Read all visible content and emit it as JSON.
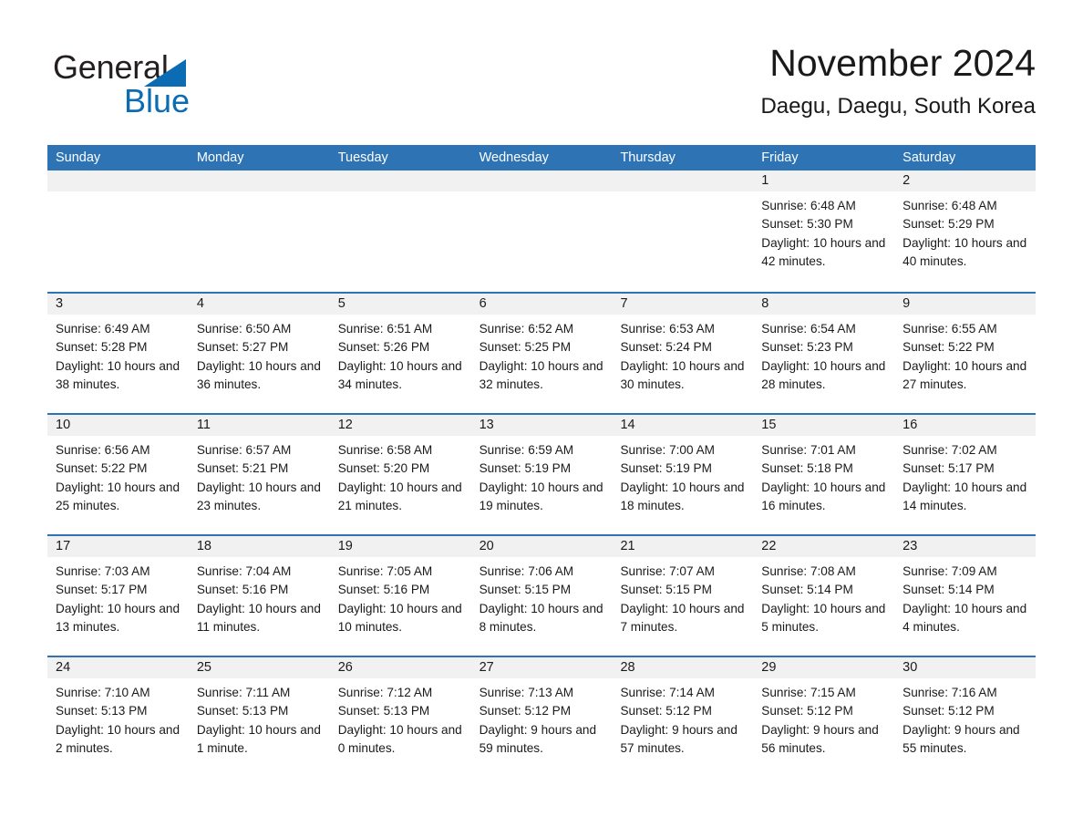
{
  "brand": {
    "name_part1": "General",
    "name_part2": "Blue",
    "triangle_icon": "triangle-icon",
    "colors": {
      "blue": "#0b6cb4",
      "black": "#231f20"
    }
  },
  "header": {
    "title": "November 2024",
    "subtitle": "Daegu, Daegu, South Korea"
  },
  "theme": {
    "header_blue": "#2e74b5",
    "daynum_band": "#f1f1f1",
    "text": "#1a1a1a"
  },
  "weekdays": [
    "Sunday",
    "Monday",
    "Tuesday",
    "Wednesday",
    "Thursday",
    "Friday",
    "Saturday"
  ],
  "weeks": [
    [
      {
        "day": "",
        "sunrise": "",
        "sunset": "",
        "daylight": ""
      },
      {
        "day": "",
        "sunrise": "",
        "sunset": "",
        "daylight": ""
      },
      {
        "day": "",
        "sunrise": "",
        "sunset": "",
        "daylight": ""
      },
      {
        "day": "",
        "sunrise": "",
        "sunset": "",
        "daylight": ""
      },
      {
        "day": "",
        "sunrise": "",
        "sunset": "",
        "daylight": ""
      },
      {
        "day": "1",
        "sunrise": "Sunrise: 6:48 AM",
        "sunset": "Sunset: 5:30 PM",
        "daylight": "Daylight: 10 hours and 42 minutes."
      },
      {
        "day": "2",
        "sunrise": "Sunrise: 6:48 AM",
        "sunset": "Sunset: 5:29 PM",
        "daylight": "Daylight: 10 hours and 40 minutes."
      }
    ],
    [
      {
        "day": "3",
        "sunrise": "Sunrise: 6:49 AM",
        "sunset": "Sunset: 5:28 PM",
        "daylight": "Daylight: 10 hours and 38 minutes."
      },
      {
        "day": "4",
        "sunrise": "Sunrise: 6:50 AM",
        "sunset": "Sunset: 5:27 PM",
        "daylight": "Daylight: 10 hours and 36 minutes."
      },
      {
        "day": "5",
        "sunrise": "Sunrise: 6:51 AM",
        "sunset": "Sunset: 5:26 PM",
        "daylight": "Daylight: 10 hours and 34 minutes."
      },
      {
        "day": "6",
        "sunrise": "Sunrise: 6:52 AM",
        "sunset": "Sunset: 5:25 PM",
        "daylight": "Daylight: 10 hours and 32 minutes."
      },
      {
        "day": "7",
        "sunrise": "Sunrise: 6:53 AM",
        "sunset": "Sunset: 5:24 PM",
        "daylight": "Daylight: 10 hours and 30 minutes."
      },
      {
        "day": "8",
        "sunrise": "Sunrise: 6:54 AM",
        "sunset": "Sunset: 5:23 PM",
        "daylight": "Daylight: 10 hours and 28 minutes."
      },
      {
        "day": "9",
        "sunrise": "Sunrise: 6:55 AM",
        "sunset": "Sunset: 5:22 PM",
        "daylight": "Daylight: 10 hours and 27 minutes."
      }
    ],
    [
      {
        "day": "10",
        "sunrise": "Sunrise: 6:56 AM",
        "sunset": "Sunset: 5:22 PM",
        "daylight": "Daylight: 10 hours and 25 minutes."
      },
      {
        "day": "11",
        "sunrise": "Sunrise: 6:57 AM",
        "sunset": "Sunset: 5:21 PM",
        "daylight": "Daylight: 10 hours and 23 minutes."
      },
      {
        "day": "12",
        "sunrise": "Sunrise: 6:58 AM",
        "sunset": "Sunset: 5:20 PM",
        "daylight": "Daylight: 10 hours and 21 minutes."
      },
      {
        "day": "13",
        "sunrise": "Sunrise: 6:59 AM",
        "sunset": "Sunset: 5:19 PM",
        "daylight": "Daylight: 10 hours and 19 minutes."
      },
      {
        "day": "14",
        "sunrise": "Sunrise: 7:00 AM",
        "sunset": "Sunset: 5:19 PM",
        "daylight": "Daylight: 10 hours and 18 minutes."
      },
      {
        "day": "15",
        "sunrise": "Sunrise: 7:01 AM",
        "sunset": "Sunset: 5:18 PM",
        "daylight": "Daylight: 10 hours and 16 minutes."
      },
      {
        "day": "16",
        "sunrise": "Sunrise: 7:02 AM",
        "sunset": "Sunset: 5:17 PM",
        "daylight": "Daylight: 10 hours and 14 minutes."
      }
    ],
    [
      {
        "day": "17",
        "sunrise": "Sunrise: 7:03 AM",
        "sunset": "Sunset: 5:17 PM",
        "daylight": "Daylight: 10 hours and 13 minutes."
      },
      {
        "day": "18",
        "sunrise": "Sunrise: 7:04 AM",
        "sunset": "Sunset: 5:16 PM",
        "daylight": "Daylight: 10 hours and 11 minutes."
      },
      {
        "day": "19",
        "sunrise": "Sunrise: 7:05 AM",
        "sunset": "Sunset: 5:16 PM",
        "daylight": "Daylight: 10 hours and 10 minutes."
      },
      {
        "day": "20",
        "sunrise": "Sunrise: 7:06 AM",
        "sunset": "Sunset: 5:15 PM",
        "daylight": "Daylight: 10 hours and 8 minutes."
      },
      {
        "day": "21",
        "sunrise": "Sunrise: 7:07 AM",
        "sunset": "Sunset: 5:15 PM",
        "daylight": "Daylight: 10 hours and 7 minutes."
      },
      {
        "day": "22",
        "sunrise": "Sunrise: 7:08 AM",
        "sunset": "Sunset: 5:14 PM",
        "daylight": "Daylight: 10 hours and 5 minutes."
      },
      {
        "day": "23",
        "sunrise": "Sunrise: 7:09 AM",
        "sunset": "Sunset: 5:14 PM",
        "daylight": "Daylight: 10 hours and 4 minutes."
      }
    ],
    [
      {
        "day": "24",
        "sunrise": "Sunrise: 7:10 AM",
        "sunset": "Sunset: 5:13 PM",
        "daylight": "Daylight: 10 hours and 2 minutes."
      },
      {
        "day": "25",
        "sunrise": "Sunrise: 7:11 AM",
        "sunset": "Sunset: 5:13 PM",
        "daylight": "Daylight: 10 hours and 1 minute."
      },
      {
        "day": "26",
        "sunrise": "Sunrise: 7:12 AM",
        "sunset": "Sunset: 5:13 PM",
        "daylight": "Daylight: 10 hours and 0 minutes."
      },
      {
        "day": "27",
        "sunrise": "Sunrise: 7:13 AM",
        "sunset": "Sunset: 5:12 PM",
        "daylight": "Daylight: 9 hours and 59 minutes."
      },
      {
        "day": "28",
        "sunrise": "Sunrise: 7:14 AM",
        "sunset": "Sunset: 5:12 PM",
        "daylight": "Daylight: 9 hours and 57 minutes."
      },
      {
        "day": "29",
        "sunrise": "Sunrise: 7:15 AM",
        "sunset": "Sunset: 5:12 PM",
        "daylight": "Daylight: 9 hours and 56 minutes."
      },
      {
        "day": "30",
        "sunrise": "Sunrise: 7:16 AM",
        "sunset": "Sunset: 5:12 PM",
        "daylight": "Daylight: 9 hours and 55 minutes."
      }
    ]
  ]
}
